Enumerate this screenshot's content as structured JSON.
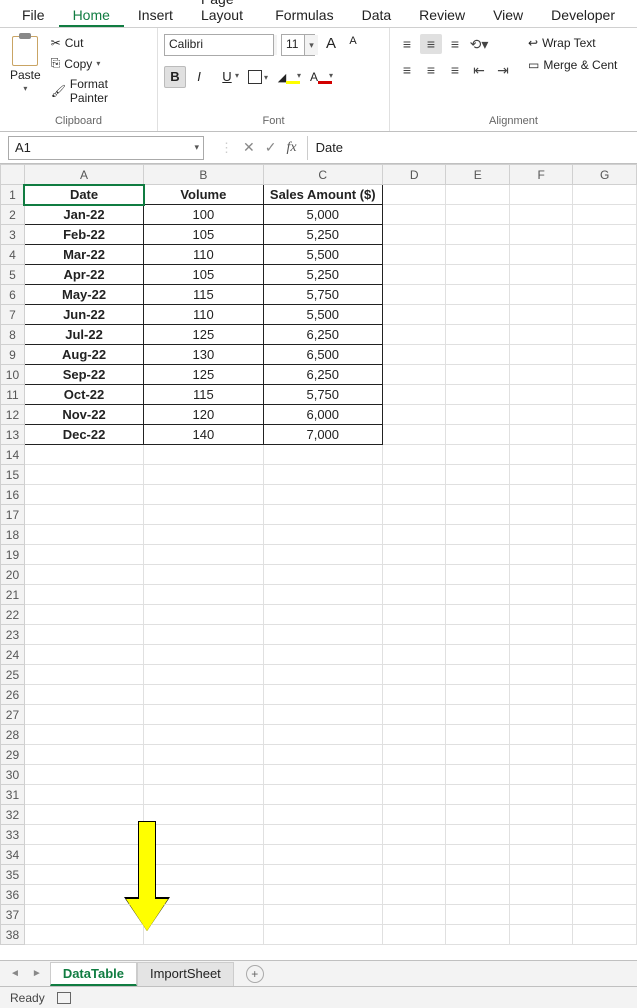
{
  "ribbon_tabs": [
    "File",
    "Home",
    "Insert",
    "Page Layout",
    "Formulas",
    "Data",
    "Review",
    "View",
    "Developer"
  ],
  "active_tab": "Home",
  "clipboard": {
    "cut": "Cut",
    "copy": "Copy",
    "format_painter": "Format Painter",
    "paste": "Paste",
    "group": "Clipboard"
  },
  "font": {
    "name": "Calibri",
    "size": "11",
    "group": "Font",
    "bold": "B",
    "italic": "I",
    "underline": "U",
    "grow": "A",
    "shrink": "A"
  },
  "alignment": {
    "group": "Alignment",
    "wrap": "Wrap Text",
    "merge": "Merge & Cent"
  },
  "name_box": "A1",
  "formula_value": "Date",
  "columns": [
    "A",
    "B",
    "C",
    "D",
    "E",
    "F",
    "G"
  ],
  "col_widths": [
    "col-A",
    "col-B",
    "col-C",
    "col-D",
    "col-E",
    "col-F",
    "col-G"
  ],
  "header_row": [
    "Date",
    "Volume",
    "Sales Amount ($)"
  ],
  "data_rows": [
    [
      "Jan-22",
      "100",
      "5,000"
    ],
    [
      "Feb-22",
      "105",
      "5,250"
    ],
    [
      "Mar-22",
      "110",
      "5,500"
    ],
    [
      "Apr-22",
      "105",
      "5,250"
    ],
    [
      "May-22",
      "115",
      "5,750"
    ],
    [
      "Jun-22",
      "110",
      "5,500"
    ],
    [
      "Jul-22",
      "125",
      "6,250"
    ],
    [
      "Aug-22",
      "130",
      "6,500"
    ],
    [
      "Sep-22",
      "125",
      "6,250"
    ],
    [
      "Oct-22",
      "115",
      "5,750"
    ],
    [
      "Nov-22",
      "120",
      "6,000"
    ],
    [
      "Dec-22",
      "140",
      "7,000"
    ]
  ],
  "empty_rows": 25,
  "sheet_tabs": [
    {
      "name": "DataTable",
      "active": true
    },
    {
      "name": "ImportSheet",
      "active": false
    }
  ],
  "status": "Ready",
  "chart_data": {
    "type": "table",
    "title": "",
    "columns": [
      "Date",
      "Volume",
      "Sales Amount ($)"
    ],
    "rows": [
      {
        "Date": "Jan-22",
        "Volume": 100,
        "Sales Amount ($)": 5000
      },
      {
        "Date": "Feb-22",
        "Volume": 105,
        "Sales Amount ($)": 5250
      },
      {
        "Date": "Mar-22",
        "Volume": 110,
        "Sales Amount ($)": 5500
      },
      {
        "Date": "Apr-22",
        "Volume": 105,
        "Sales Amount ($)": 5250
      },
      {
        "Date": "May-22",
        "Volume": 115,
        "Sales Amount ($)": 5750
      },
      {
        "Date": "Jun-22",
        "Volume": 110,
        "Sales Amount ($)": 5500
      },
      {
        "Date": "Jul-22",
        "Volume": 125,
        "Sales Amount ($)": 6250
      },
      {
        "Date": "Aug-22",
        "Volume": 130,
        "Sales Amount ($)": 6500
      },
      {
        "Date": "Sep-22",
        "Volume": 125,
        "Sales Amount ($)": 6250
      },
      {
        "Date": "Oct-22",
        "Volume": 115,
        "Sales Amount ($)": 5750
      },
      {
        "Date": "Nov-22",
        "Volume": 120,
        "Sales Amount ($)": 6000
      },
      {
        "Date": "Dec-22",
        "Volume": 140,
        "Sales Amount ($)": 7000
      }
    ]
  }
}
